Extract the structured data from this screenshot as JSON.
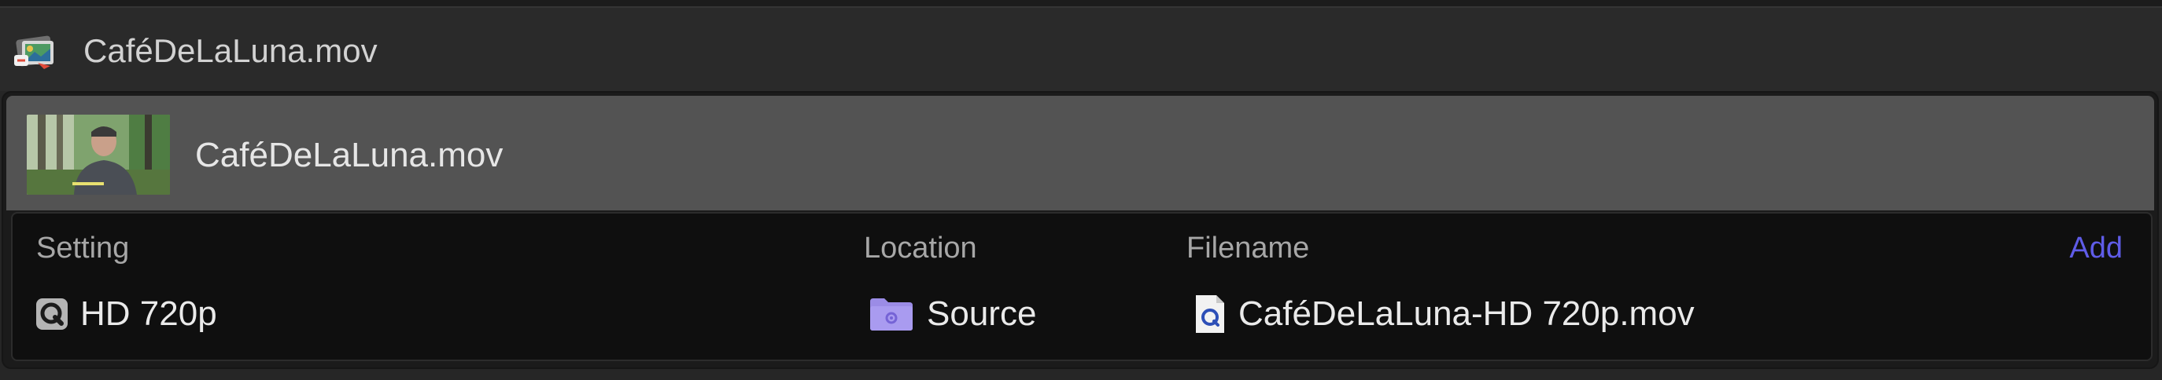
{
  "window": {
    "title": "CaféDeLaLuna.mov",
    "icon": "compressor-app-icon"
  },
  "job": {
    "title": "CaféDeLaLuna.mov",
    "thumbnail": "video-thumbnail-person-outdoors"
  },
  "outputs": {
    "headers": {
      "setting": "Setting",
      "location": "Location",
      "filename": "Filename"
    },
    "add_label": "Add",
    "rows": [
      {
        "setting": "HD 720p",
        "setting_icon": "quicktime-icon",
        "location": "Source",
        "location_icon": "folder-icon",
        "filename": "CaféDeLaLuna-HD 720p.mov",
        "filename_icon": "movie-file-icon"
      }
    ]
  },
  "colors": {
    "background": "#262626",
    "job_row": "#535353",
    "outputs_panel": "#0f0f0f",
    "accent": "#5f5ce8",
    "folder": "#9b8ce6"
  }
}
